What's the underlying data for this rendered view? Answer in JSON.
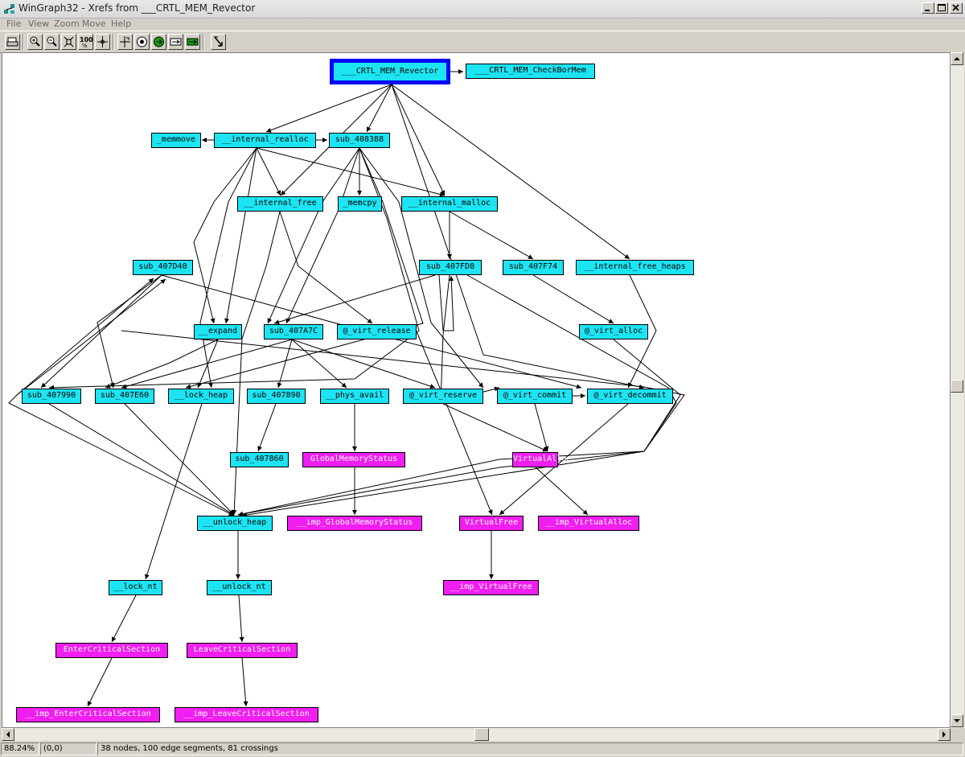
{
  "window": {
    "title": "WinGraph32 - Xrefs from ___CRTL_MEM_Revector"
  },
  "menu": [
    "File",
    "View",
    "Zoom",
    "Move",
    "Help"
  ],
  "toolbar": {
    "zoom_100_label": "100"
  },
  "colors": {
    "code_node": "#1ce4f2",
    "import_node": "#f01ef0",
    "root_border": "#0000ff"
  },
  "graph": {
    "nodes": [
      "___CRTL_MEM_Revector",
      "___CRTL_MEM_CheckBorMem",
      "_memmove",
      "__internal_realloc",
      "sub_408388",
      "__internal_free",
      "_memcpy",
      "__internal_malloc",
      "sub_407D40",
      "sub_407FD8",
      "sub_407F74",
      "__internal_free_heaps",
      "__expand",
      "sub_407A7C",
      "@_virt_release",
      "@_virt_alloc",
      "sub_407990",
      "sub_407E60",
      "__lock_heap",
      "sub_407890",
      "__phys_avail",
      "@_virt_reserve",
      "@_virt_commit",
      "@_virt_decommit",
      "sub_407860",
      "GlobalMemoryStatus",
      "VirtualAlloc",
      "__unlock_heap",
      "__imp_GlobalMemoryStatus",
      "VirtualFree",
      "__imp_VirtualAlloc",
      "__lock_nt",
      "__unlock_nt",
      "__imp_VirtualFree",
      "EnterCriticalSection",
      "LeaveCriticalSection",
      "__imp_EnterCriticalSection",
      "__imp_LeaveCriticalSection"
    ]
  },
  "status": {
    "zoom": "88.24%",
    "coords": "(0,0)",
    "info": "38 nodes, 100 edge segments, 81 crossings"
  }
}
